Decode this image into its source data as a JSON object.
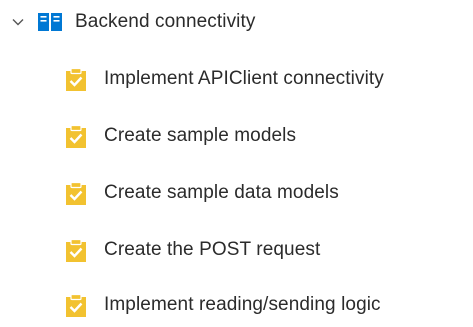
{
  "tree": {
    "parent": {
      "label": "Backend connectivity",
      "expanded": true,
      "icon": "epic-book-icon",
      "icon_color": "#0078d4"
    },
    "children": [
      {
        "label": "Implement APIClient connectivity",
        "icon": "task-clipboard-icon"
      },
      {
        "label": "Create sample models",
        "icon": "task-clipboard-icon"
      },
      {
        "label": "Create sample data models",
        "icon": "task-clipboard-icon"
      },
      {
        "label": "Create the POST request",
        "icon": "task-clipboard-icon"
      },
      {
        "label": "Implement reading/sending logic",
        "icon": "task-clipboard-icon"
      }
    ],
    "task_icon_color": "#f2c230",
    "check_color": "#ffffff"
  }
}
